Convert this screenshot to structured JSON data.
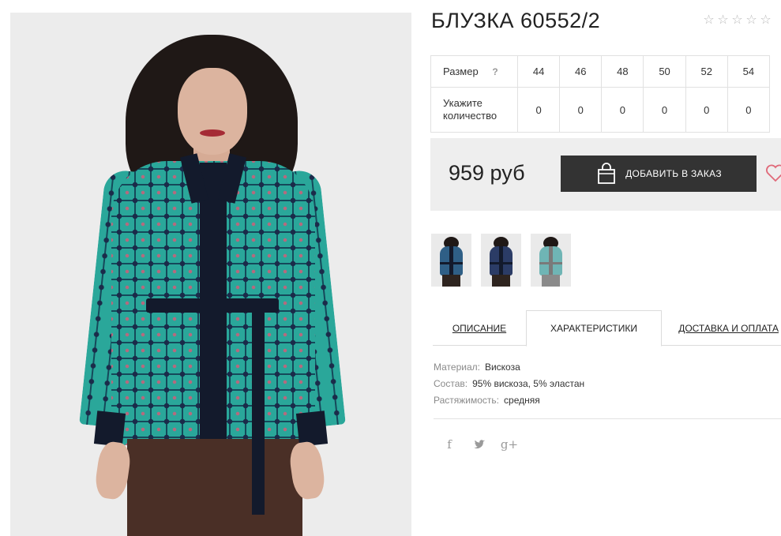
{
  "product": {
    "title": "БЛУЗКА 60552/2",
    "rating": {
      "value": 0,
      "max": 5
    },
    "main_image_icon": "product-photo",
    "colors": {
      "fabric": "#2aa79a",
      "trim": "#131a2c",
      "pants": "#4a2f26"
    }
  },
  "size_table": {
    "size_label": "Размер",
    "help_mark": "?",
    "qty_label_line1": "Укажите",
    "qty_label_line2": "количество",
    "sizes": [
      "44",
      "46",
      "48",
      "50",
      "52",
      "54"
    ],
    "quantities": [
      "0",
      "0",
      "0",
      "0",
      "0",
      "0"
    ]
  },
  "buy": {
    "price": "959 руб",
    "order_button": "ДОБАВИТЬ В ЗАКАЗ",
    "bag_icon": "shopping-bag-icon",
    "wishlist_icon": "heart-icon",
    "accent_color": "#e06a7a",
    "button_color": "#333333"
  },
  "thumbnails": [
    {
      "name": "thumb-1",
      "color": "#2f5f86"
    },
    {
      "name": "thumb-2",
      "color": "#2b3c66"
    },
    {
      "name": "thumb-3",
      "color": "#6fb5b5"
    }
  ],
  "tabs": {
    "description": "ОПИСАНИЕ",
    "characteristics": "ХАРАКТЕРИСТИКИ",
    "delivery": "ДОСТАВКА И ОПЛАТА",
    "active": "characteristics"
  },
  "characteristics": [
    {
      "key": "Материал:",
      "value": "Вискоза"
    },
    {
      "key": "Состав:",
      "value": "95% вискоза, 5% эластан"
    },
    {
      "key": "Растяжимость:",
      "value": "средняя"
    }
  ],
  "social": {
    "facebook": "f",
    "twitter": "twitter-icon",
    "google_plus": "g+"
  }
}
